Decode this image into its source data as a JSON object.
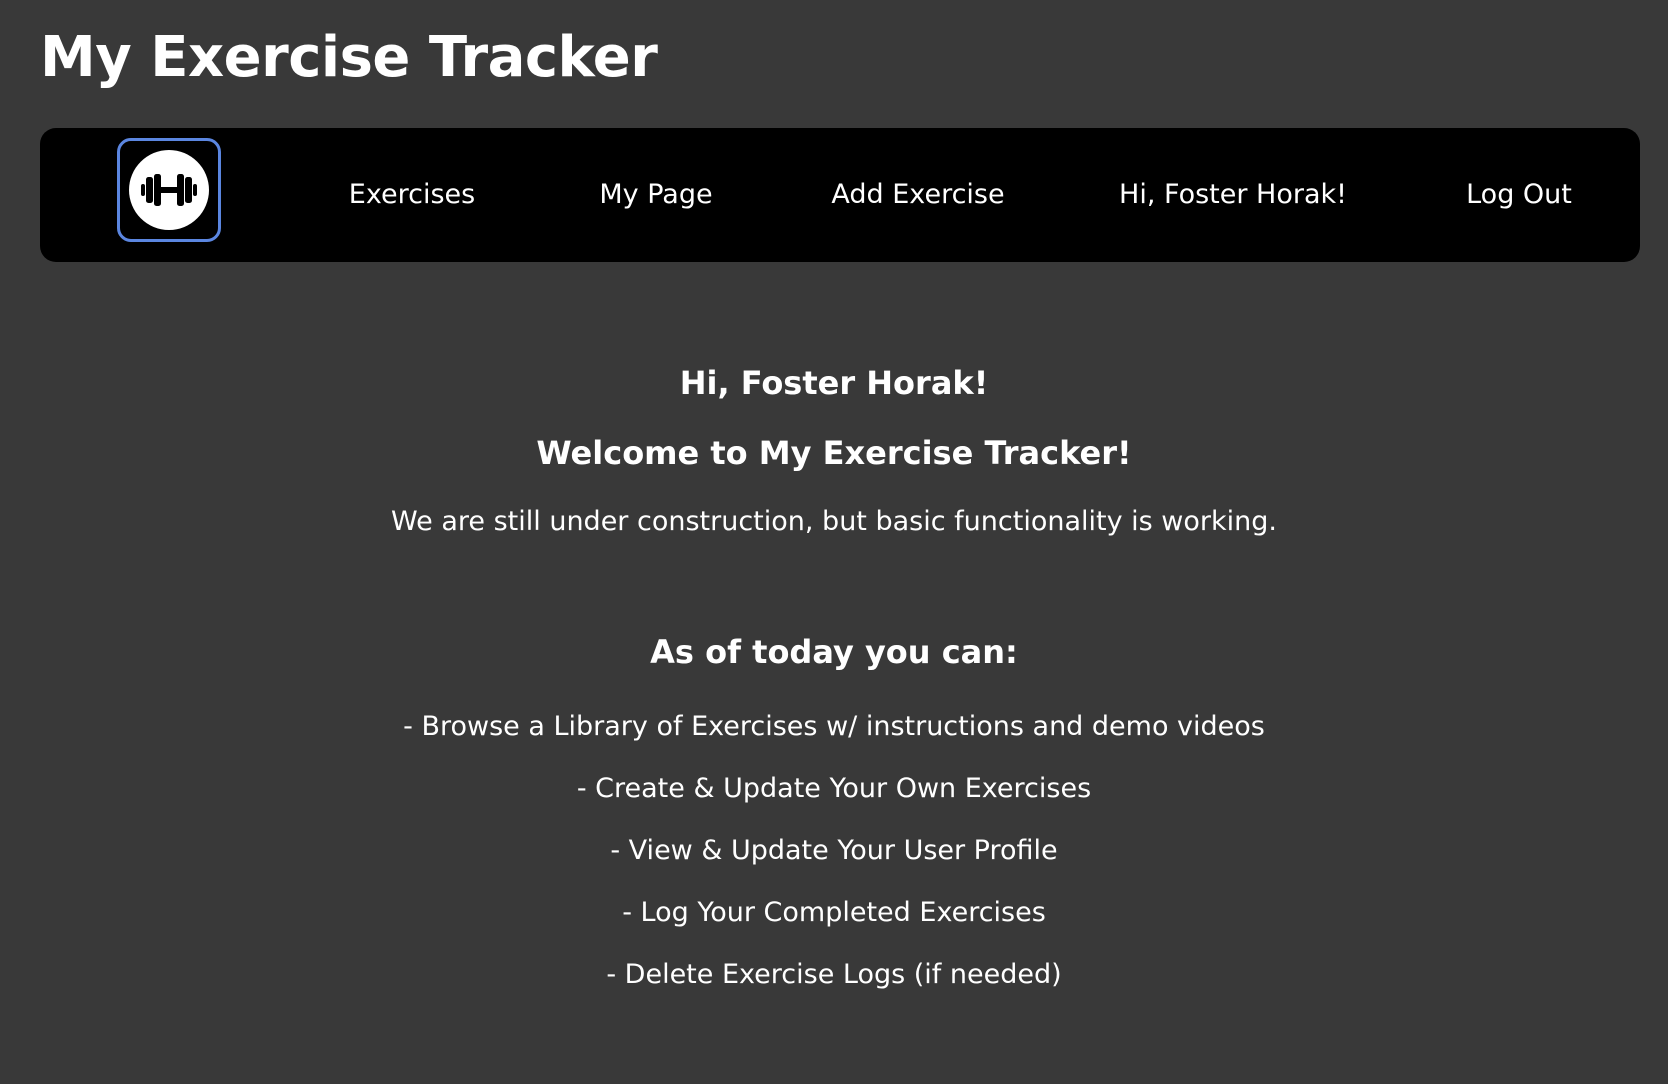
{
  "app": {
    "title": "My Exercise Tracker"
  },
  "nav": {
    "logo_icon": "dumbbell-icon",
    "links": [
      {
        "label": "Exercises"
      },
      {
        "label": "My Page"
      },
      {
        "label": "Add Exercise"
      },
      {
        "label": "Hi, Foster Horak!"
      },
      {
        "label": "Log Out"
      }
    ]
  },
  "main": {
    "greeting": "Hi, Foster Horak!",
    "welcome": "Welcome to My Exercise Tracker!",
    "intro": "We are still under construction, but basic functionality is working.",
    "features_heading": "As of today you can:",
    "features": [
      "- Browse a Library of Exercises w/ instructions and demo videos",
      "- Create & Update Your Own Exercises",
      "- View & Update Your User Profile",
      "- Log Your Completed Exercises",
      "- Delete Exercise Logs (if needed)"
    ]
  },
  "colors": {
    "background": "#393939",
    "navbar": "#000000",
    "logo_border": "#5b86e0",
    "text": "#ffffff"
  }
}
